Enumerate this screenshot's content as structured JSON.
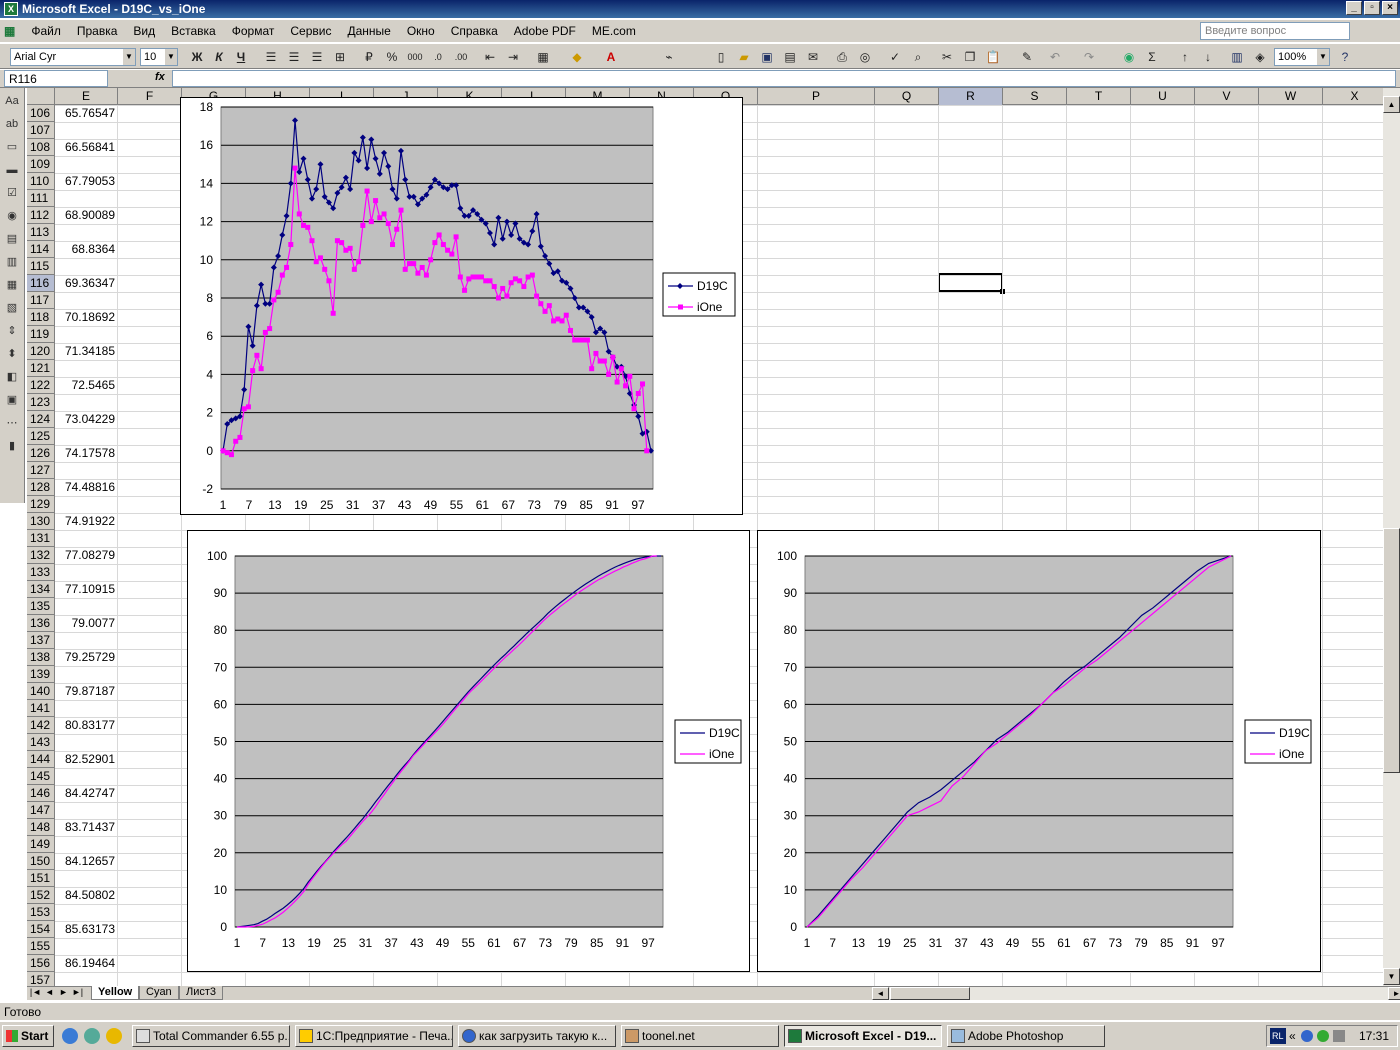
{
  "window": {
    "title": "Microsoft Excel - D19C_vs_iOne"
  },
  "menu": [
    "Файл",
    "Правка",
    "Вид",
    "Вставка",
    "Формат",
    "Сервис",
    "Данные",
    "Окно",
    "Справка",
    "Adobe PDF",
    "ME.com"
  ],
  "ask_placeholder": "Введите вопрос",
  "toolbar": {
    "font": "Arial Cyr",
    "size": "10",
    "zoom": "100%",
    "bold": "Ж",
    "italic": "К",
    "underline": "Ч",
    "percent": "%",
    "thousands": "000",
    "sigma": "Σ"
  },
  "formula_bar": {
    "name_box": "R116",
    "fx": "fx",
    "content": ""
  },
  "columns": [
    "E",
    "F",
    "G",
    "H",
    "I",
    "J",
    "K",
    "L",
    "M",
    "N",
    "O",
    "P",
    "Q",
    "R",
    "S",
    "T",
    "U",
    "V",
    "W",
    "X"
  ],
  "selected_column": "R",
  "rows": [
    106,
    107,
    108,
    109,
    110,
    111,
    112,
    113,
    114,
    115,
    116,
    117,
    118,
    119,
    120,
    121,
    122,
    123,
    124,
    125,
    126,
    127,
    128,
    129,
    130,
    131,
    132,
    133,
    134,
    135,
    136,
    137,
    138,
    139,
    140,
    141,
    142,
    143,
    144,
    145,
    146,
    147,
    148,
    149,
    150,
    151,
    152,
    153,
    154,
    155,
    156,
    157
  ],
  "selected_row": 116,
  "column_e_values": [
    "65.76547",
    "",
    "66.56841",
    "",
    "67.79053",
    "",
    "68.90089",
    "",
    "68.8364",
    "",
    "69.36347",
    "",
    "70.18692",
    "",
    "71.34185",
    "",
    "72.5465",
    "",
    "73.04229",
    "",
    "74.17578",
    "",
    "74.48816",
    "",
    "74.91922",
    "",
    "77.08279",
    "",
    "77.10915",
    "",
    "79.0077",
    "",
    "79.25729",
    "",
    "79.87187",
    "",
    "80.83177",
    "",
    "82.52901",
    "",
    "84.42747",
    "",
    "83.71437",
    "",
    "84.12657",
    "",
    "84.50802",
    "",
    "85.63173",
    "",
    "86.19464",
    ""
  ],
  "sheet_tabs": [
    "Yellow",
    "Cyan",
    "Лист3"
  ],
  "active_tab": "Yellow",
  "status": "Готово",
  "taskbar": {
    "start": "Start",
    "tasks": [
      "Total Commander 6.55 p...",
      "1С:Предприятие - Печа...",
      "как загрузить такую к...",
      "toonel.net",
      "Microsoft Excel - D19...",
      "Adobe Photoshop"
    ],
    "active_task": "Microsoft Excel - D19...",
    "lang": "RL",
    "time": "17:31"
  },
  "chart_data": [
    {
      "type": "line",
      "x_tick_labels": [
        "1",
        "7",
        "13",
        "19",
        "25",
        "31",
        "37",
        "43",
        "49",
        "55",
        "61",
        "67",
        "73",
        "79",
        "85",
        "91",
        "97"
      ],
      "ylim": [
        -2,
        18
      ],
      "y_ticks": [
        -2,
        0,
        2,
        4,
        6,
        8,
        10,
        12,
        14,
        16,
        18
      ],
      "legend_position": "right",
      "series": [
        {
          "name": "D19C",
          "color": "#000080",
          "marker": "diamond",
          "values": [
            0,
            1.4,
            1.6,
            1.7,
            1.8,
            3.2,
            6.5,
            5.5,
            7.6,
            8.7,
            7.7,
            7.7,
            9.6,
            10.2,
            11.3,
            12.3,
            14,
            17.3,
            14.6,
            15.3,
            14.2,
            13.2,
            13.7,
            15,
            13.3,
            13,
            12.7,
            13.5,
            13.8,
            14.3,
            13.7,
            15.6,
            15.2,
            16.4,
            14.8,
            16.3,
            15.3,
            14.5,
            15.6,
            14.9,
            13.7,
            13.2,
            15.7,
            14.2,
            13.3,
            13.3,
            12.9,
            13.2,
            13.4,
            13.8,
            14.2,
            14,
            13.8,
            13.7,
            13.9,
            13.9,
            12.7,
            12.3,
            12.3,
            12.6,
            12.4,
            12.1,
            11.9,
            11.4,
            10.8,
            12.2,
            11.1,
            12,
            11.3,
            11.9,
            11.1,
            10.9,
            10.8,
            11.5,
            12.4,
            10.7,
            10.2,
            9.8,
            9.3,
            9.4,
            8.9,
            8.8,
            8.5,
            8,
            7.5,
            7.5,
            7.3,
            7,
            6.2,
            6.4,
            6.2,
            5.2,
            4.9,
            4.4,
            4.4,
            3.9,
            3,
            2.4,
            1.8,
            0.9,
            1,
            0
          ]
        },
        {
          "name": "iOne",
          "color": "#ff00ff",
          "marker": "square",
          "values": [
            0,
            -0.1,
            -0.2,
            0.5,
            0.7,
            2.2,
            2.3,
            4.2,
            5,
            4.3,
            6.2,
            6.4,
            7.9,
            8.3,
            9.2,
            9.6,
            10.8,
            14.8,
            12.4,
            11.8,
            11.7,
            11,
            9.9,
            10.1,
            9.5,
            8.9,
            7.2,
            11,
            10.9,
            10.5,
            10.6,
            9.5,
            9.9,
            11.8,
            13.6,
            12,
            13.1,
            12.2,
            12.4,
            11.9,
            10.8,
            11.6,
            12.6,
            9.5,
            9.8,
            9.8,
            9.3,
            9.6,
            9.2,
            10,
            10.9,
            11.3,
            10.8,
            10.5,
            10.3,
            11.2,
            9.1,
            8.4,
            9,
            9.1,
            9.1,
            9.1,
            8.9,
            8.9,
            8.6,
            8,
            8.5,
            8.1,
            8.8,
            9,
            8.9,
            8.6,
            9.1,
            9.2,
            8.1,
            7.7,
            7.3,
            7.6,
            6.8,
            6.9,
            6.8,
            7.1,
            6.3,
            5.8,
            5.8,
            5.8,
            5.8,
            4.3,
            5.1,
            4.7,
            4.7,
            4,
            4.9,
            3.6,
            4.3,
            3.4,
            3.9,
            2.2,
            3,
            3.5,
            0
          ]
        }
      ]
    },
    {
      "type": "line",
      "x_tick_labels": [
        "1",
        "7",
        "13",
        "19",
        "25",
        "31",
        "37",
        "43",
        "49",
        "55",
        "61",
        "67",
        "73",
        "79",
        "85",
        "91",
        "97"
      ],
      "ylim": [
        0,
        100
      ],
      "y_ticks": [
        0,
        10,
        20,
        30,
        40,
        50,
        60,
        70,
        80,
        90,
        100
      ],
      "legend_position": "right",
      "series": [
        {
          "name": "D19C",
          "color": "#000080",
          "values_cumulative_from": "chart1.D19C"
        },
        {
          "name": "iOne",
          "color": "#ff00ff",
          "values_cumulative_from": "chart1.iOne"
        }
      ]
    },
    {
      "type": "line",
      "x_tick_labels": [
        "1",
        "7",
        "13",
        "19",
        "25",
        "31",
        "37",
        "43",
        "49",
        "55",
        "61",
        "67",
        "73",
        "79",
        "85",
        "91",
        "97"
      ],
      "ylim": [
        0,
        100
      ],
      "y_ticks": [
        0,
        10,
        20,
        30,
        40,
        50,
        60,
        70,
        80,
        90,
        100
      ],
      "legend_position": "right",
      "series": [
        {
          "name": "D19C",
          "color": "#000080",
          "values": [
            0,
            3,
            6.5,
            10,
            13.5,
            17,
            20.5,
            24,
            27.5,
            31,
            33.5,
            35,
            37,
            39.5,
            42,
            44.5,
            47.5,
            50.5,
            52.5,
            55,
            57.5,
            60,
            63,
            66,
            68.5,
            70.5,
            73,
            75.5,
            78,
            81,
            84,
            86,
            88.5,
            91,
            93.5,
            96,
            98,
            99,
            100
          ]
        },
        {
          "name": "iOne",
          "color": "#ff00ff",
          "values": [
            0,
            2.5,
            6,
            9.5,
            13,
            16,
            19.5,
            23,
            26.5,
            30,
            31,
            32.5,
            34,
            38,
            40.5,
            44,
            47.5,
            49.5,
            52,
            54.5,
            57,
            60,
            63,
            65,
            67.5,
            70,
            72,
            74.5,
            77,
            79.5,
            82,
            84.5,
            87,
            89.5,
            92,
            94.5,
            97,
            98.5,
            100
          ]
        }
      ]
    }
  ]
}
